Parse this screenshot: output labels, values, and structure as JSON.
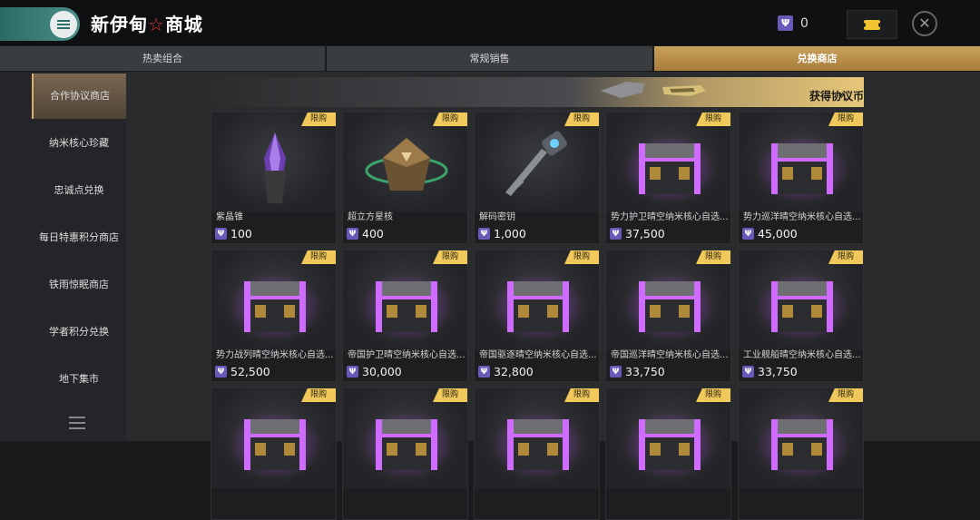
{
  "header": {
    "title_part1": "新伊甸",
    "title_star": "☆",
    "title_part2": "商城",
    "currency_value": "0",
    "icons": {
      "menu": "menu-icon",
      "currency": "protocol-coin-icon",
      "ticket": "ticket-icon",
      "close": "close-icon"
    }
  },
  "tabs": [
    {
      "label": "热卖组合",
      "active": false
    },
    {
      "label": "常规销售",
      "active": false
    },
    {
      "label": "兑换商店",
      "active": true
    }
  ],
  "sidebar": {
    "items": [
      {
        "label": "合作协议商店",
        "active": true
      },
      {
        "label": "纳米核心珍藏",
        "active": false
      },
      {
        "label": "忠诚点兑换",
        "active": false
      },
      {
        "label": "每日特惠积分商店",
        "active": false
      },
      {
        "label": "铁雨惊眠商店",
        "active": false
      },
      {
        "label": "学者积分兑换",
        "active": false
      },
      {
        "label": "地下集市",
        "active": false
      }
    ]
  },
  "banner": {
    "label": "获得协议币",
    "arrow": "»"
  },
  "limit_badge": "限购",
  "coin_glyph": "Ψ",
  "items": [
    {
      "name": "紫晶锥",
      "price": "100",
      "art": "crystal"
    },
    {
      "name": "超立方星核",
      "price": "400",
      "art": "core"
    },
    {
      "name": "解码密钥",
      "price": "1,000",
      "art": "key"
    },
    {
      "name": "势力护卫晴空纳米核心自选...",
      "price": "37,500",
      "art": "chest"
    },
    {
      "name": "势力巡洋晴空纳米核心自选...",
      "price": "45,000",
      "art": "chest"
    },
    {
      "name": "势力战列晴空纳米核心自选...",
      "price": "52,500",
      "art": "chest"
    },
    {
      "name": "帝国护卫晴空纳米核心自选...",
      "price": "30,000",
      "art": "chest"
    },
    {
      "name": "帝国驱逐晴空纳米核心自选...",
      "price": "32,800",
      "art": "chest"
    },
    {
      "name": "帝国巡洋晴空纳米核心自选...",
      "price": "33,750",
      "art": "chest"
    },
    {
      "name": "工业舰船晴空纳米核心自选...",
      "price": "33,750",
      "art": "chest"
    },
    {
      "name": "",
      "price": "",
      "art": "chest"
    },
    {
      "name": "",
      "price": "",
      "art": "chest"
    },
    {
      "name": "",
      "price": "",
      "art": "chest"
    },
    {
      "name": "",
      "price": "",
      "art": "chest"
    },
    {
      "name": "",
      "price": "",
      "art": "chest"
    }
  ],
  "colors": {
    "accent_gold": "#e7c77a",
    "teal": "#3f8a83",
    "coin_purple": "#6a58b8",
    "chest_glow": "#c247ff"
  }
}
